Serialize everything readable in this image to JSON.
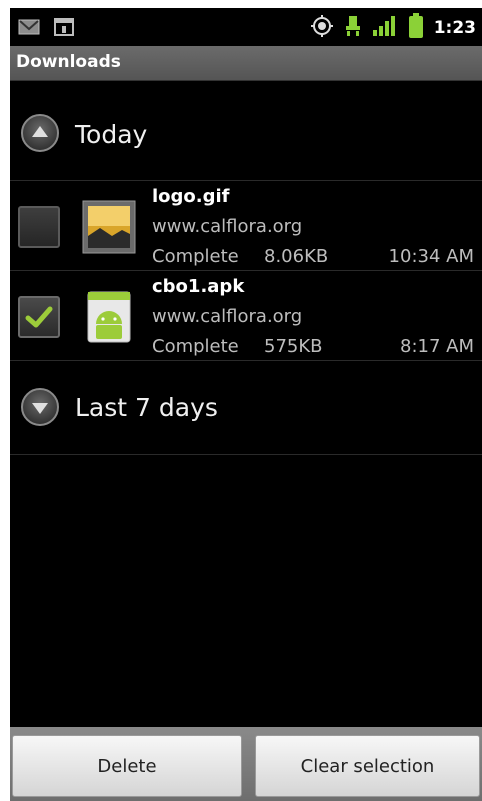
{
  "status_bar": {
    "time": "1:23",
    "icons": [
      "gmail-icon",
      "calendar-icon",
      "gps-icon",
      "usb-debug-icon",
      "signal-icon",
      "battery-icon"
    ]
  },
  "title_bar": {
    "title": "Downloads"
  },
  "groups": [
    {
      "label": "Today",
      "expanded": true,
      "items": [
        {
          "filename": "logo.gif",
          "source": "www.calflora.org",
          "status": "Complete",
          "size": "8.06KB",
          "time": "10:34 AM",
          "checked": false,
          "icon": "image-file-icon"
        },
        {
          "filename": "cbo1.apk",
          "source": "www.calflora.org",
          "status": "Complete",
          "size": "575KB",
          "time": "8:17 AM",
          "checked": true,
          "icon": "android-apk-icon"
        }
      ]
    },
    {
      "label": "Last 7 days",
      "expanded": false,
      "items": []
    }
  ],
  "actions": {
    "delete_label": "Delete",
    "clear_label": "Clear selection"
  },
  "colors": {
    "background": "#000000",
    "title_bar": "#5f5f5f",
    "accent_check": "#9ccc3a",
    "status_icon_green": "#8bd137"
  }
}
